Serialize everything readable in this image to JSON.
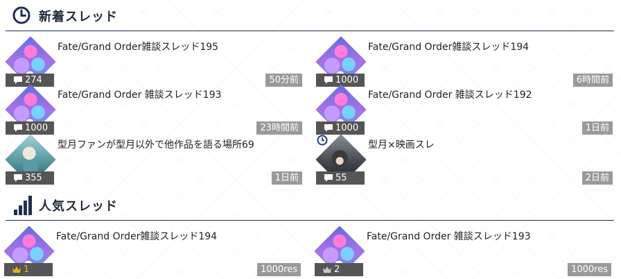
{
  "new_threads": {
    "title": "新着スレッド",
    "icon": "clock-icon",
    "items": [
      {
        "title": "Fate/Grand Order雑談スレッド195",
        "count": "274",
        "time": "50分前",
        "thumb": "fgo"
      },
      {
        "title": "Fate/Grand Order雑談スレッド194",
        "count": "1000",
        "time": "6時間前",
        "thumb": "fgo"
      },
      {
        "title": "Fate/Grand Order 雑談スレッド193",
        "count": "1000",
        "time": "23時間前",
        "thumb": "fgo"
      },
      {
        "title": "Fate/Grand Order 雑談スレッド192",
        "count": "1000",
        "time": "1日前",
        "thumb": "fgo"
      },
      {
        "title": "型月ファンが型月以外で他作品を語る場所69",
        "count": "355",
        "time": "1日前",
        "thumb": "anime"
      },
      {
        "title": "型月×映画スレ",
        "count": "55",
        "time": "2日前",
        "thumb": "movie"
      }
    ]
  },
  "popular_threads": {
    "title": "人気スレッド",
    "icon": "ranking-bars-icon",
    "items": [
      {
        "title": "Fate/Grand Order雑談スレッド194",
        "rank": "1",
        "res": "1000res",
        "thumb": "fgo"
      },
      {
        "title": "Fate/Grand Order 雑談スレッド193",
        "rank": "2",
        "res": "1000res",
        "thumb": "fgo"
      }
    ]
  },
  "colors": {
    "navy": "#1e3050",
    "badge_dark": "#555555",
    "badge_light": "#9a9a9a",
    "crown_gold": "#e0b020",
    "crown_silver": "#c8c8c8"
  }
}
